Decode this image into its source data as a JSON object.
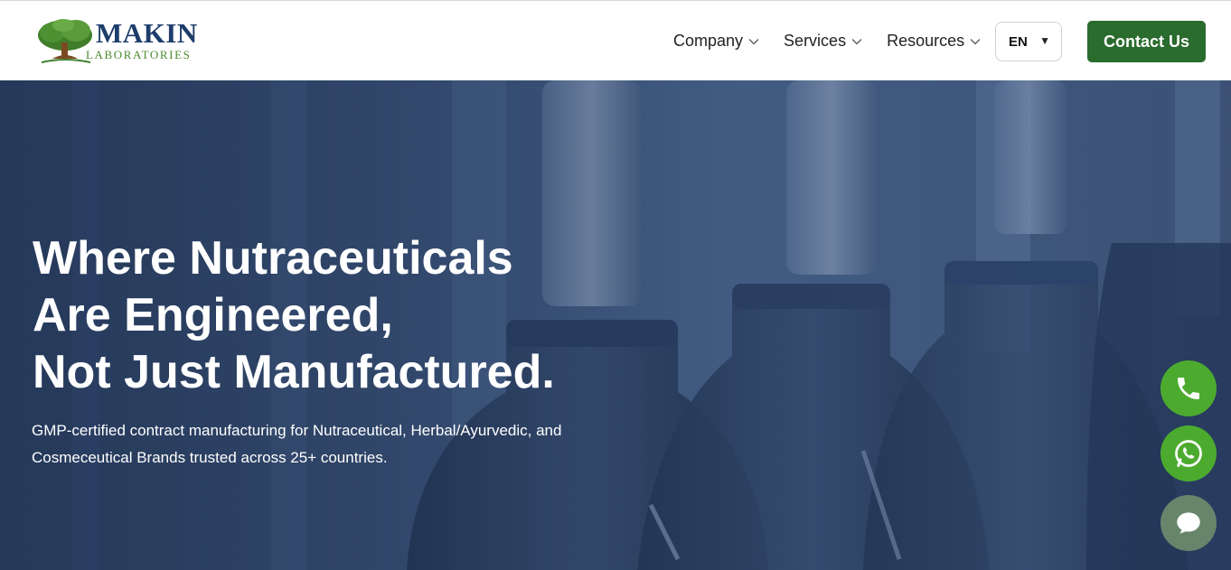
{
  "brand": {
    "name": "MAKIN",
    "tagline": "LABORATORIES"
  },
  "nav": {
    "items": [
      {
        "label": "Company"
      },
      {
        "label": "Services"
      },
      {
        "label": "Resources"
      }
    ],
    "language": "EN",
    "contact_label": "Contact Us"
  },
  "hero": {
    "title_lines": [
      "Where Nutraceuticals",
      "Are Engineered,",
      "Not Just Manufactured."
    ],
    "subtitle_line1": "GMP-certified contract manufacturing for Nutraceutical, Herbal/Ayurvedic, and",
    "subtitle_line2": "Cosmeceutical Brands trusted across 25+ countries."
  },
  "floating_actions": [
    {
      "icon": "phone-icon"
    },
    {
      "icon": "whatsapp-icon"
    },
    {
      "icon": "chat-icon"
    }
  ],
  "colors": {
    "brand_navy": "#1e3d6b",
    "brand_green": "#4b8a2f",
    "contact_button": "#2a6b2e",
    "float_green": "#4cab2f",
    "float_chat": "#67856a"
  }
}
